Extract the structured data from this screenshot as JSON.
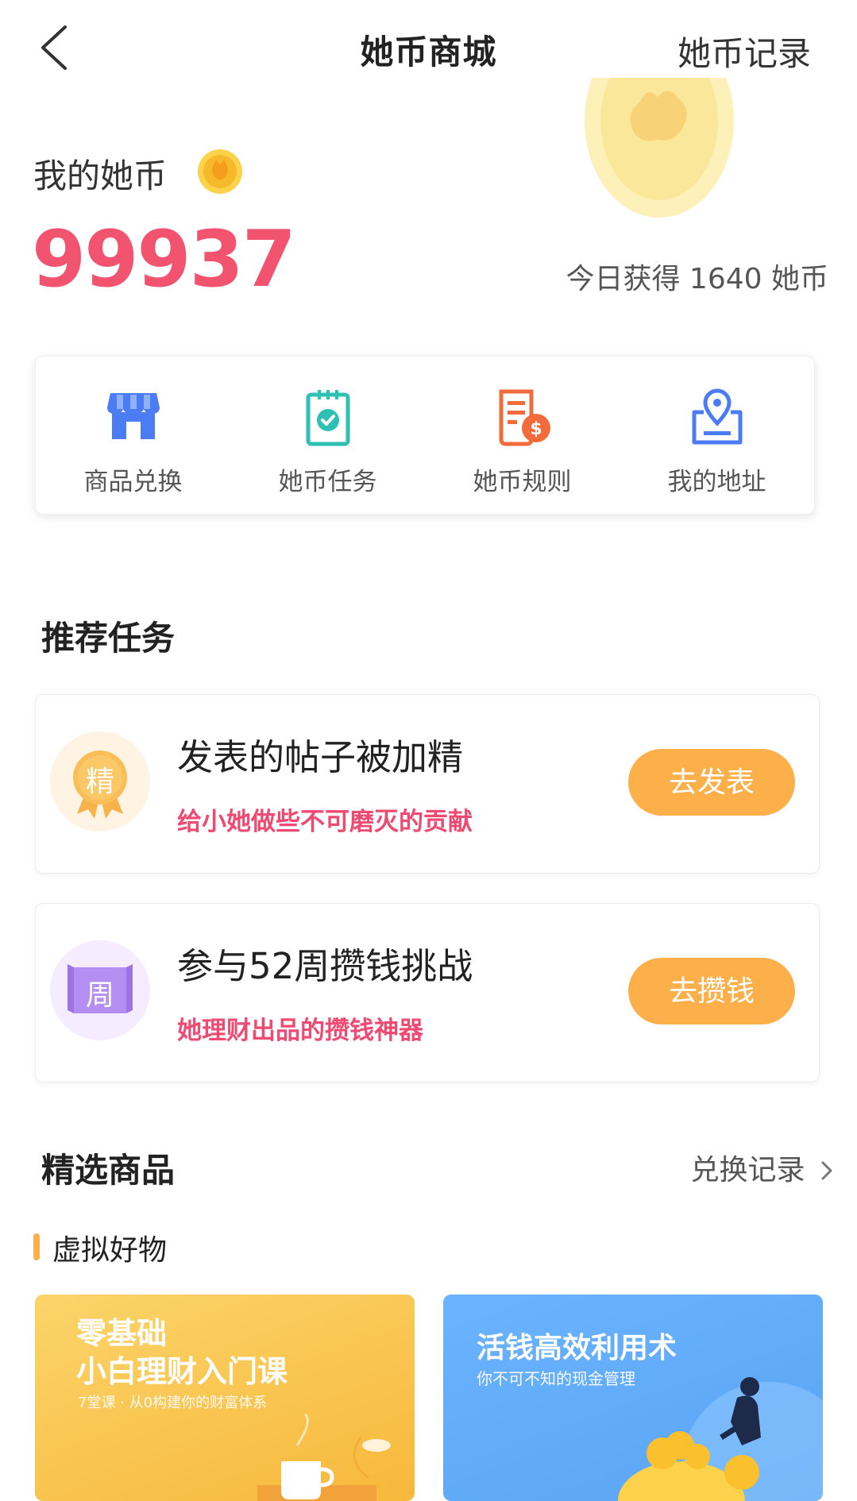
{
  "header": {
    "title": "她币商城",
    "right_link": "她币记录"
  },
  "balance": {
    "label": "我的她币",
    "value": "99937",
    "today_text": "今日获得 1640 她币"
  },
  "quick_actions": [
    {
      "label": "商品兑换",
      "icon": "store-icon"
    },
    {
      "label": "她币任务",
      "icon": "task-clipboard-icon"
    },
    {
      "label": "她币规则",
      "icon": "rules-document-icon"
    },
    {
      "label": "我的地址",
      "icon": "location-pin-icon"
    }
  ],
  "recommended": {
    "title": "推荐任务",
    "tasks": [
      {
        "badge_char": "精",
        "title": "发表的帖子被加精",
        "subtitle": "给小她做些不可磨灭的贡献",
        "button": "去发表"
      },
      {
        "badge_char": "周",
        "title": "参与52周攒钱挑战",
        "subtitle": "她理财出品的攒钱神器",
        "button": "去攒钱"
      }
    ]
  },
  "featured": {
    "title": "精选商品",
    "more_link": "兑换记录",
    "category": "虚拟好物",
    "products": [
      {
        "line1": "零基础",
        "line2": "小白理财入门课",
        "desc": "7堂课 · 从0构建你的财富体系"
      },
      {
        "line1": "活钱高效利用术",
        "desc": "你不可不知的现金管理"
      }
    ]
  },
  "colors": {
    "accent_pink": "#f2536f",
    "button_orange": "#fdb04a",
    "icon_blue": "#4b7cf3"
  }
}
